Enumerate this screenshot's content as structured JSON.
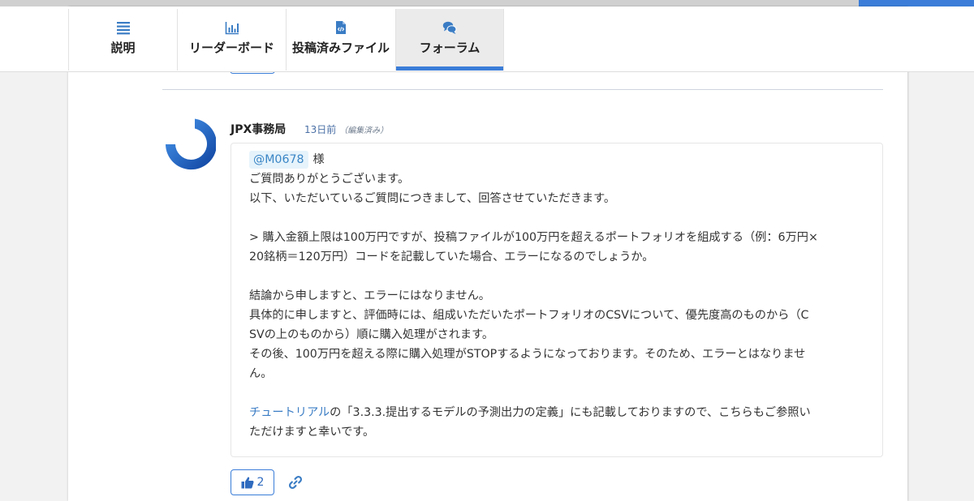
{
  "tabs": [
    {
      "label": "説明",
      "icon": "list-icon",
      "active": false
    },
    {
      "label": "リーダーボード",
      "icon": "bar-chart-icon",
      "active": false
    },
    {
      "label": "投稿済みファイル",
      "icon": "code-file-icon",
      "active": false
    },
    {
      "label": "フォーラム",
      "icon": "chat-bubbles-icon",
      "active": true
    }
  ],
  "post": {
    "author": "JPX事務局",
    "time": "13日前",
    "edited": "（編集済み）",
    "mention": "@M0678",
    "salutation": "様",
    "lines": [
      "ご質問ありがとうございます。",
      " 以下、いただいているご質問につきまして、回答させていただきます。",
      "",
      "> 購入金額上限は100万円ですが、投稿ファイルが100万円を超えるポートフォリオを組成する（例：6万円×",
      "20銘柄＝120万円）コードを記載していた場合、エラーになるのでしょうか。",
      "",
      "結論から申しますと、エラーにはなりません。",
      "具体的に申しますと、評価時には、組成いただいたポートフォリオのCSVについて、優先度高のものから（C",
      "SVの上のものから）順に購入処理がされます。",
      " その後、100万円を超える際に購入処理がSTOPするようになっております。そのため、エラーとはなりませ",
      "ん。",
      ""
    ],
    "tutorial_link": "チュートリアル",
    "tutorial_rest": "の「3.3.3.提出するモデルの予測出力の定義」にも記載しておりますので、こちらもご参照い",
    "closing": "ただけますと幸いです。",
    "likes": "2"
  },
  "colors": {
    "accent": "#3b7dd8",
    "mention_bg": "#e6f3fb",
    "link": "#3a7cc4"
  }
}
